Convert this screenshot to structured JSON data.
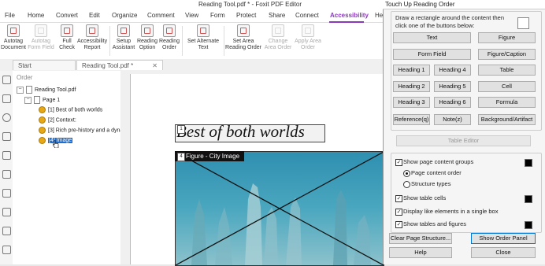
{
  "window": {
    "title": "Reading Tool.pdf * - Foxit PDF Editor"
  },
  "menu": [
    "File",
    "Home",
    "Convert",
    "Edit",
    "Organize",
    "Comment",
    "View",
    "Form",
    "Protect",
    "Share",
    "Connect",
    "Accessibility",
    "He"
  ],
  "ribbon": {
    "autotag_document": "Autotag Document",
    "autotag_form_field": "Autotag Form Field",
    "full_check": "Full Check",
    "accessibility_report": "Accessibility Report",
    "setup_assistant": "Setup Assistant",
    "reading_option": "Reading Option",
    "reading_order": "Reading Order",
    "set_alternate_text": "Set Alternate Text",
    "set_area_reading_order": "Set Area Reading Order",
    "change_area_order": "Change Area Order",
    "apply_area_order": "Apply Area Order"
  },
  "tabs": [
    {
      "label": "Start"
    },
    {
      "label": "Reading Tool.pdf *"
    }
  ],
  "order_panel": {
    "title": "Order",
    "file": "Reading Tool.pdf",
    "page": "Page 1",
    "items": [
      "[1] Best of both worlds",
      "[2] Context:",
      "[3] Rich pre-history and a dyna",
      "[4] Image"
    ]
  },
  "document": {
    "heading": "Best of both worlds",
    "figure_label": "Figure - City Image"
  },
  "dialog": {
    "title": "Touch Up Reading Order",
    "instructions": "Draw a rectangle around the content then click one of the buttons below:",
    "buttons": [
      "Text",
      "Figure",
      "Form Field",
      "Figure/Caption",
      "Heading 1",
      "Heading 4",
      "Table",
      "Heading 2",
      "Heading 5",
      "Cell",
      "Heading 3",
      "Heading 6",
      "Formula",
      "Reference(q)",
      "Note(z)",
      "Background/Artifact"
    ],
    "table_editor": "Table Editor",
    "options": {
      "show_page_content_groups": "Show page content groups",
      "page_content_order": "Page content order",
      "structure_types": "Structure types",
      "show_table_cells": "Show table cells",
      "display_like_elements": "Display like elements in a single box",
      "show_tables_and_figures": "Show tables and figures"
    },
    "clear_page_structure": "Clear Page Structure...",
    "show_order_panel": "Show Order Panel",
    "help": "Help",
    "close": "Close"
  }
}
